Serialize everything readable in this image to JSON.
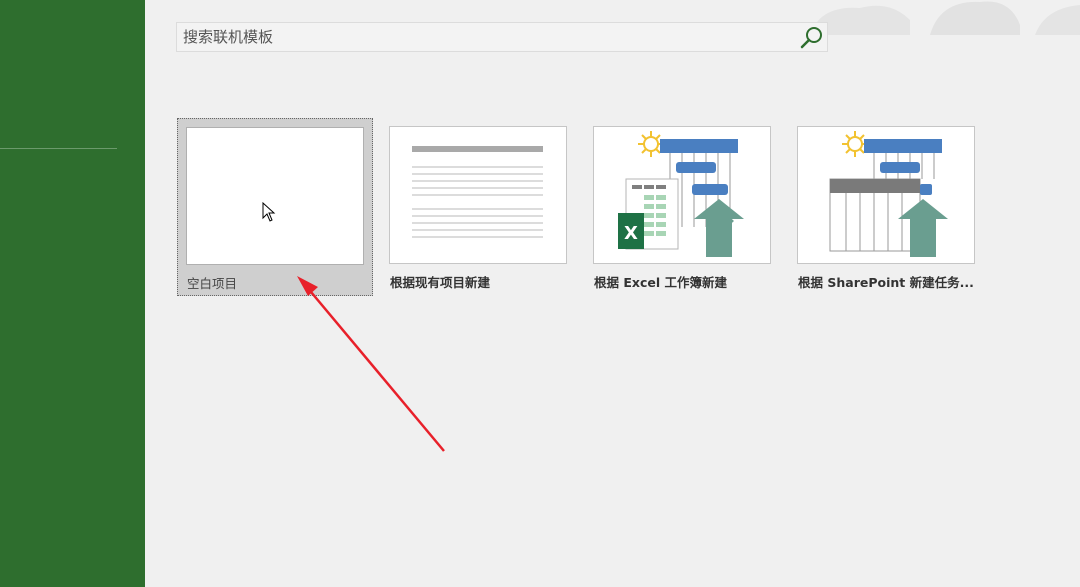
{
  "search": {
    "placeholder": "搜索联机模板"
  },
  "templates": [
    {
      "label": "空白项目"
    },
    {
      "label": "根据现有项目新建"
    },
    {
      "label": "根据 Excel 工作簿新建"
    },
    {
      "label": "根据 SharePoint 新建任务..."
    }
  ],
  "icons": {
    "search": "search-icon",
    "cursor": "mouse-pointer-icon"
  },
  "colors": {
    "sidebar": "#2e6e2e",
    "gantt_blue": "#4a7fc1",
    "arrow_teal": "#6a9e90",
    "excel_green": "#1e7145",
    "annotation_red": "#e8202a"
  }
}
